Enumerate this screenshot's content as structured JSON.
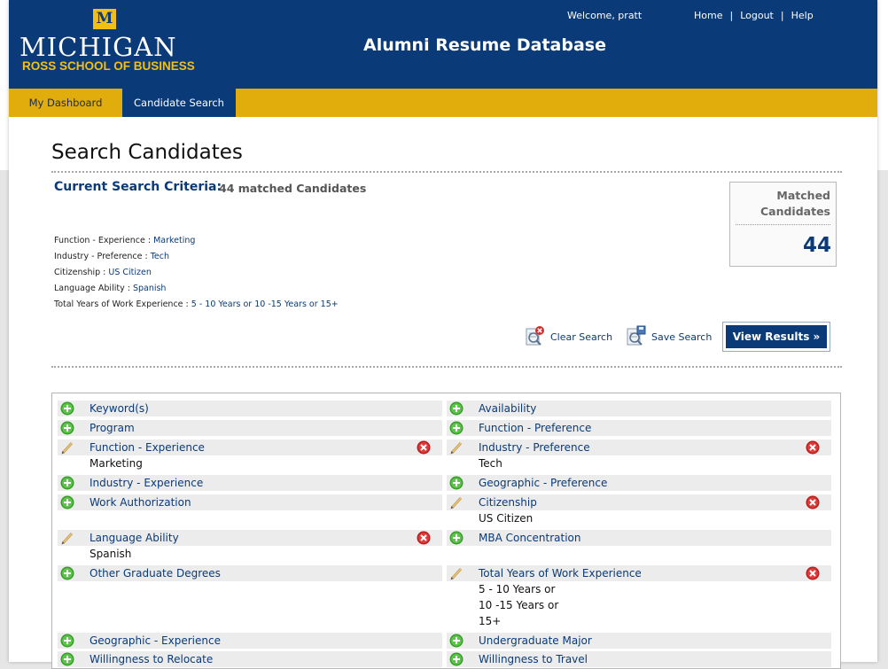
{
  "header": {
    "logo_letter": "M",
    "logo_michigan": "MICHIGAN",
    "logo_ross": "ROSS SCHOOL OF BUSINESS",
    "title": "Alumni Resume Database",
    "welcome": "Welcome, pratt",
    "links": {
      "home": "Home",
      "logout": "Logout",
      "help": "Help",
      "sep": "|"
    },
    "colors": {
      "brand_blue": "#0a3a78",
      "brand_gold": "#e1ad0c"
    }
  },
  "nav": {
    "dashboard": "My Dashboard",
    "candidate_search": "Candidate Search"
  },
  "page": {
    "title": "Search Candidates"
  },
  "criteria": {
    "title": "Current Search Criteria:",
    "count_text": "44 matched Candidates",
    "items": [
      {
        "label": "Function - Experience : ",
        "value": "Marketing"
      },
      {
        "label": "Industry - Preference : ",
        "value": "Tech"
      },
      {
        "label": "Citizenship : ",
        "value": "US Citizen"
      },
      {
        "label": "Language Ability : ",
        "value": "Spanish"
      },
      {
        "label": "Total Years of Work Experience : ",
        "value": "5 - 10 Years or 10 -15 Years or 15+"
      }
    ]
  },
  "matched": {
    "label_line1": "Matched",
    "label_line2": "Candidates",
    "count": "44"
  },
  "actions": {
    "clear": "Clear Search",
    "save": "Save Search",
    "view": "View Results »"
  },
  "filters": {
    "left": [
      {
        "label": "Keyword(s)",
        "state": "add",
        "values": []
      },
      {
        "label": "Program",
        "state": "add",
        "values": []
      },
      {
        "label": "Function - Experience",
        "state": "edit",
        "values": [
          "Marketing"
        ]
      },
      {
        "label": "Industry - Experience",
        "state": "add",
        "values": []
      },
      {
        "label": "Work Authorization",
        "state": "add",
        "values": []
      },
      {
        "label": "Language Ability",
        "state": "edit",
        "values": [
          "Spanish"
        ]
      },
      {
        "label": "Other Graduate Degrees",
        "state": "add",
        "values": []
      },
      {
        "label": "Geographic - Experience",
        "state": "add",
        "values": []
      },
      {
        "label": "Willingness to Relocate",
        "state": "add",
        "values": []
      }
    ],
    "right": [
      {
        "label": "Availability",
        "state": "add",
        "values": []
      },
      {
        "label": "Function - Preference",
        "state": "add",
        "values": []
      },
      {
        "label": "Industry - Preference",
        "state": "edit",
        "values": [
          "Tech"
        ]
      },
      {
        "label": "Geographic - Preference",
        "state": "add",
        "values": []
      },
      {
        "label": "Citizenship",
        "state": "edit",
        "values": [
          "US Citizen"
        ]
      },
      {
        "label": "MBA Concentration",
        "state": "add",
        "values": []
      },
      {
        "label": "Total Years of Work Experience",
        "state": "edit",
        "values": [
          "5 - 10 Years or",
          "10 -15 Years or",
          "15+"
        ]
      },
      {
        "label": "Undergraduate Major",
        "state": "add",
        "values": []
      },
      {
        "label": "Willingness to Travel",
        "state": "add",
        "values": []
      }
    ]
  }
}
